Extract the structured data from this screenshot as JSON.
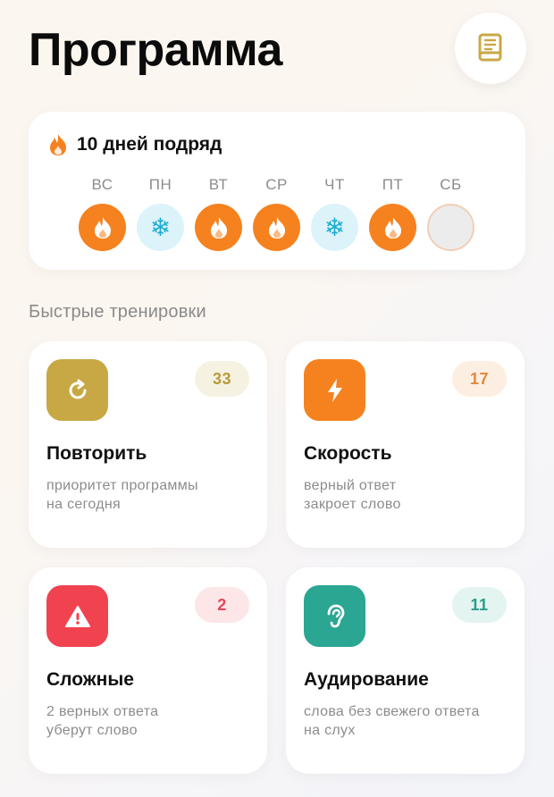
{
  "header": {
    "title": "Программа",
    "book_icon": "book-icon"
  },
  "streak": {
    "text": "10 дней подряд",
    "days": [
      {
        "label": "ВС",
        "status": "fire"
      },
      {
        "label": "ПН",
        "status": "freeze"
      },
      {
        "label": "ВТ",
        "status": "fire"
      },
      {
        "label": "СР",
        "status": "fire"
      },
      {
        "label": "ЧТ",
        "status": "freeze"
      },
      {
        "label": "ПТ",
        "status": "fire"
      },
      {
        "label": "СБ",
        "status": "empty"
      }
    ]
  },
  "section": {
    "title": "Быстрые тренировки"
  },
  "cards": [
    {
      "title": "Повторить",
      "line1": "приоритет программы",
      "line2": "на сегодня",
      "count": "33",
      "icon": "repeat-icon",
      "icon_color": "#c7a844",
      "badge_bg": "#f6f2e2",
      "badge_color": "#b89a3e"
    },
    {
      "title": "Скорость",
      "line1": "верный ответ",
      "line2": "закроет слово",
      "count": "17",
      "icon": "lightning-icon",
      "icon_color": "#f5821f",
      "badge_bg": "#fdeee2",
      "badge_color": "#e08a3c"
    },
    {
      "title": "Сложные",
      "line1": "2 верных ответа",
      "line2": "уберут слово",
      "count": "2",
      "icon": "warning-icon",
      "icon_color": "#f0434f",
      "badge_bg": "#fde6e8",
      "badge_color": "#e0485a"
    },
    {
      "title": "Аудирование",
      "line1": "слова без свежего ответа",
      "line2": "на слух",
      "count": "11",
      "icon": "ear-icon",
      "icon_color": "#2aa693",
      "badge_bg": "#e3f4f1",
      "badge_color": "#2a9d8b"
    }
  ],
  "colors": {
    "fire": "#f5821f",
    "freeze_bg": "#dcf3fa",
    "freeze_icon": "#1aaed6",
    "book": "#c9a845"
  }
}
